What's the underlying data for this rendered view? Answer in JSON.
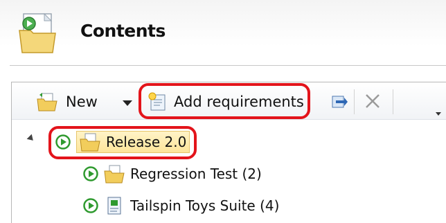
{
  "header": {
    "title": "Contents",
    "icon": "folder-page-icon"
  },
  "toolbar": {
    "new_label": "New",
    "new_icon": "folder-new-icon",
    "add_requirements_label": "Add requirements",
    "add_requirements_icon": "add-requirements-icon",
    "refresh_icon": "refresh-icon",
    "delete_icon": "delete-icon"
  },
  "tree": {
    "root": {
      "label": "Release 2.0",
      "expanded": true,
      "icon": "suite-folder-icon"
    },
    "children": [
      {
        "label": "Regression Test (2)",
        "icon": "suite-folder-icon"
      },
      {
        "label": "Tailspin Toys Suite (4)",
        "icon": "requirement-suite-icon"
      }
    ]
  },
  "colors": {
    "highlight": "#e3141b",
    "play_green": "#2f9a2f",
    "selection": "#fde59a"
  }
}
